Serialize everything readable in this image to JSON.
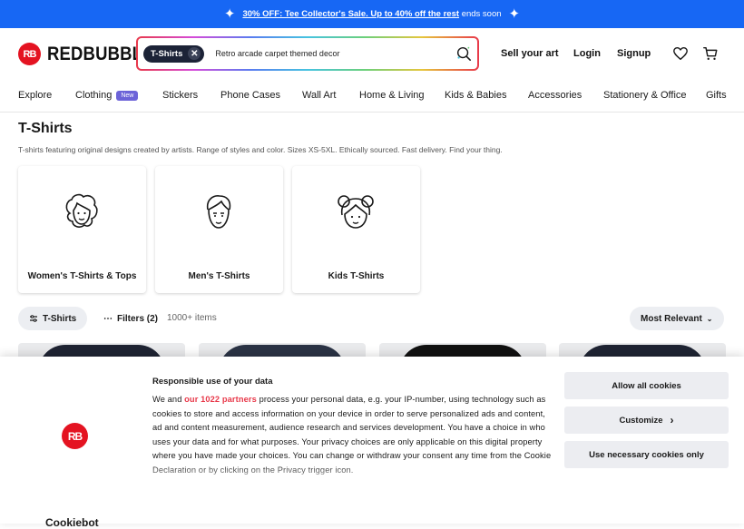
{
  "promo": {
    "link_text": "30% OFF: Tee Collector's Sale. Up to 40% off the rest",
    "suffix": "ends soon"
  },
  "header": {
    "logo_text": "REDBUBBLE",
    "logo_mark": "RB",
    "search": {
      "chip_label": "T-Shirts",
      "query": "Retro arcade carpet themed decor"
    },
    "links": {
      "sell": "Sell your art",
      "login": "Login",
      "signup": "Signup"
    },
    "icons": [
      "heart-icon",
      "cart-icon",
      "search-icon",
      "close-icon"
    ]
  },
  "nav": {
    "items": [
      "Explore",
      "Clothing",
      "Stickers",
      "Phone Cases",
      "Wall Art",
      "Home & Living",
      "Kids & Babies",
      "Accessories",
      "Stationery & Office",
      "Gifts"
    ],
    "new_badge": "New"
  },
  "page": {
    "title": "T-Shirts",
    "description": "T-shirts featuring original designs created by artists. Range of styles and color. Sizes XS-5XL. Ethically sourced. Fast delivery. Find your thing."
  },
  "categories": [
    {
      "label": "Women's T-Shirts & Tops",
      "icon": "woman-face-icon"
    },
    {
      "label": "Men's T-Shirts",
      "icon": "man-face-icon"
    },
    {
      "label": "Kids T-Shirts",
      "icon": "kid-face-icon"
    }
  ],
  "filters": {
    "tshirts_pill": "T-Shirts",
    "filters_pill": "Filters (2)",
    "count": "1000+ items",
    "sort": "Most Relevant"
  },
  "consent": {
    "title": "Responsible use of your data",
    "body_before": "We and ",
    "partners_link": "our 1022 partners",
    "body_after": " process your personal data, e.g. your IP-number, using technology such as cookies to store and access information on your device in order to serve personalized ads and content, ad and content measurement, audience research and services development. You have a choice in who uses your data and for what purposes. Your privacy choices are only applicable on this digital property where you have made your choices. You can change or withdraw your consent any time from the Cookie Declaration or by clicking on the Privacy trigger icon.",
    "buttons": {
      "allow_all": "Allow all cookies",
      "customize": "Customize",
      "necessary": "Use necessary cookies only"
    },
    "footer_brand": "Cookiebot"
  },
  "colors": {
    "promo_bg": "#1767f4",
    "brand_red": "#e41321",
    "chip_dark": "#1c2337",
    "new_badge": "#6c63d8",
    "partners_link": "#e8394a"
  }
}
